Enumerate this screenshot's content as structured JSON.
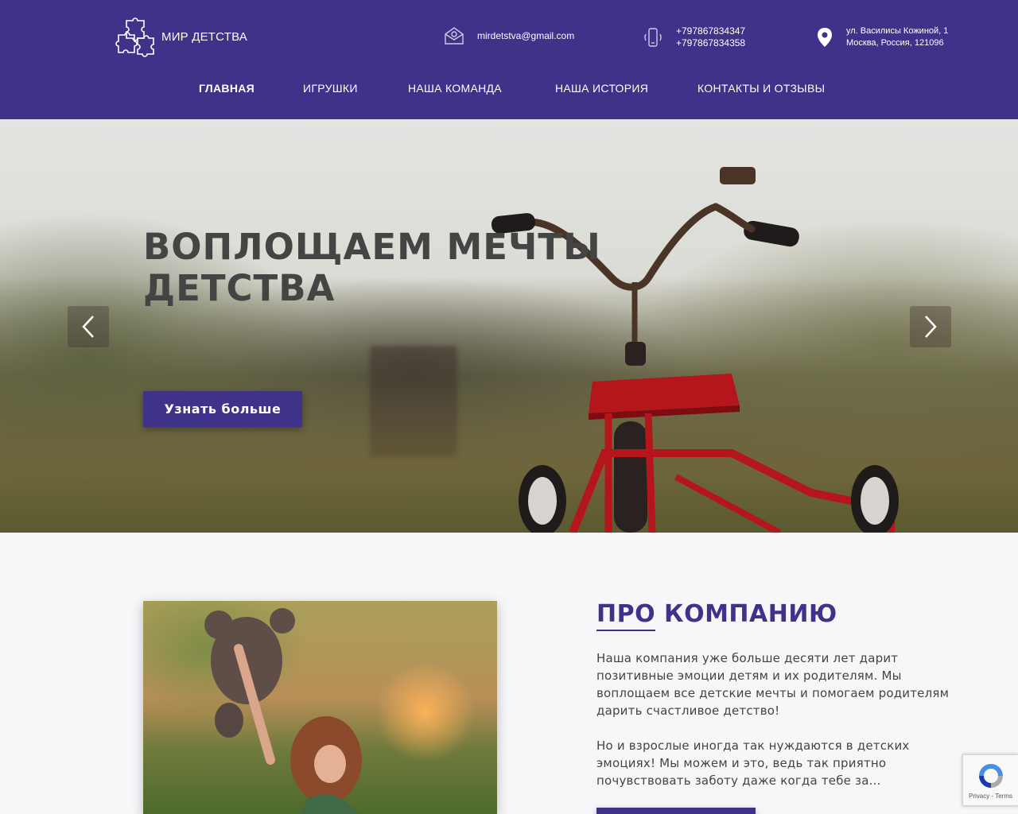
{
  "header": {
    "logo_text": "МИР ДЕТСТВА",
    "email": "mirdetstva@gmail.com",
    "phones": [
      "+797867834347",
      "+797867834358"
    ],
    "address": [
      "ул. Василисы Кожиной, 1",
      "Москва, Россия, 121096"
    ]
  },
  "nav": {
    "items": [
      {
        "label": "ГЛАВНАЯ"
      },
      {
        "label": "ИГРУШКИ"
      },
      {
        "label": "НАША КОМАНДА"
      },
      {
        "label": "НАША ИСТОРИЯ"
      },
      {
        "label": "КОНТАКТЫ И ОТЗЫВЫ"
      }
    ]
  },
  "hero": {
    "title": "ВОПЛОЩАЕМ МЕЧТЫ ДЕТСТВА",
    "button_label": "Узнать больше"
  },
  "about": {
    "title_highlight": "ПРО",
    "title_rest": " КОМПАНИЮ",
    "paragraph1": "Наша компания уже больше десяти лет дарит позитивные эмоции детям и их родителям. Мы воплощаем все детские мечты и помогаем родителям дарить счастливое детство!",
    "paragraph2": "Но и взрослые иногда так нуждаются в детских эмоциях! Мы можем и это, ведь так приятно почувствовать заботу даже когда тебе за..."
  },
  "recaptcha": {
    "links": "Privacy - Terms"
  },
  "colors": {
    "brand": "#3e3289",
    "text": "#444444"
  }
}
